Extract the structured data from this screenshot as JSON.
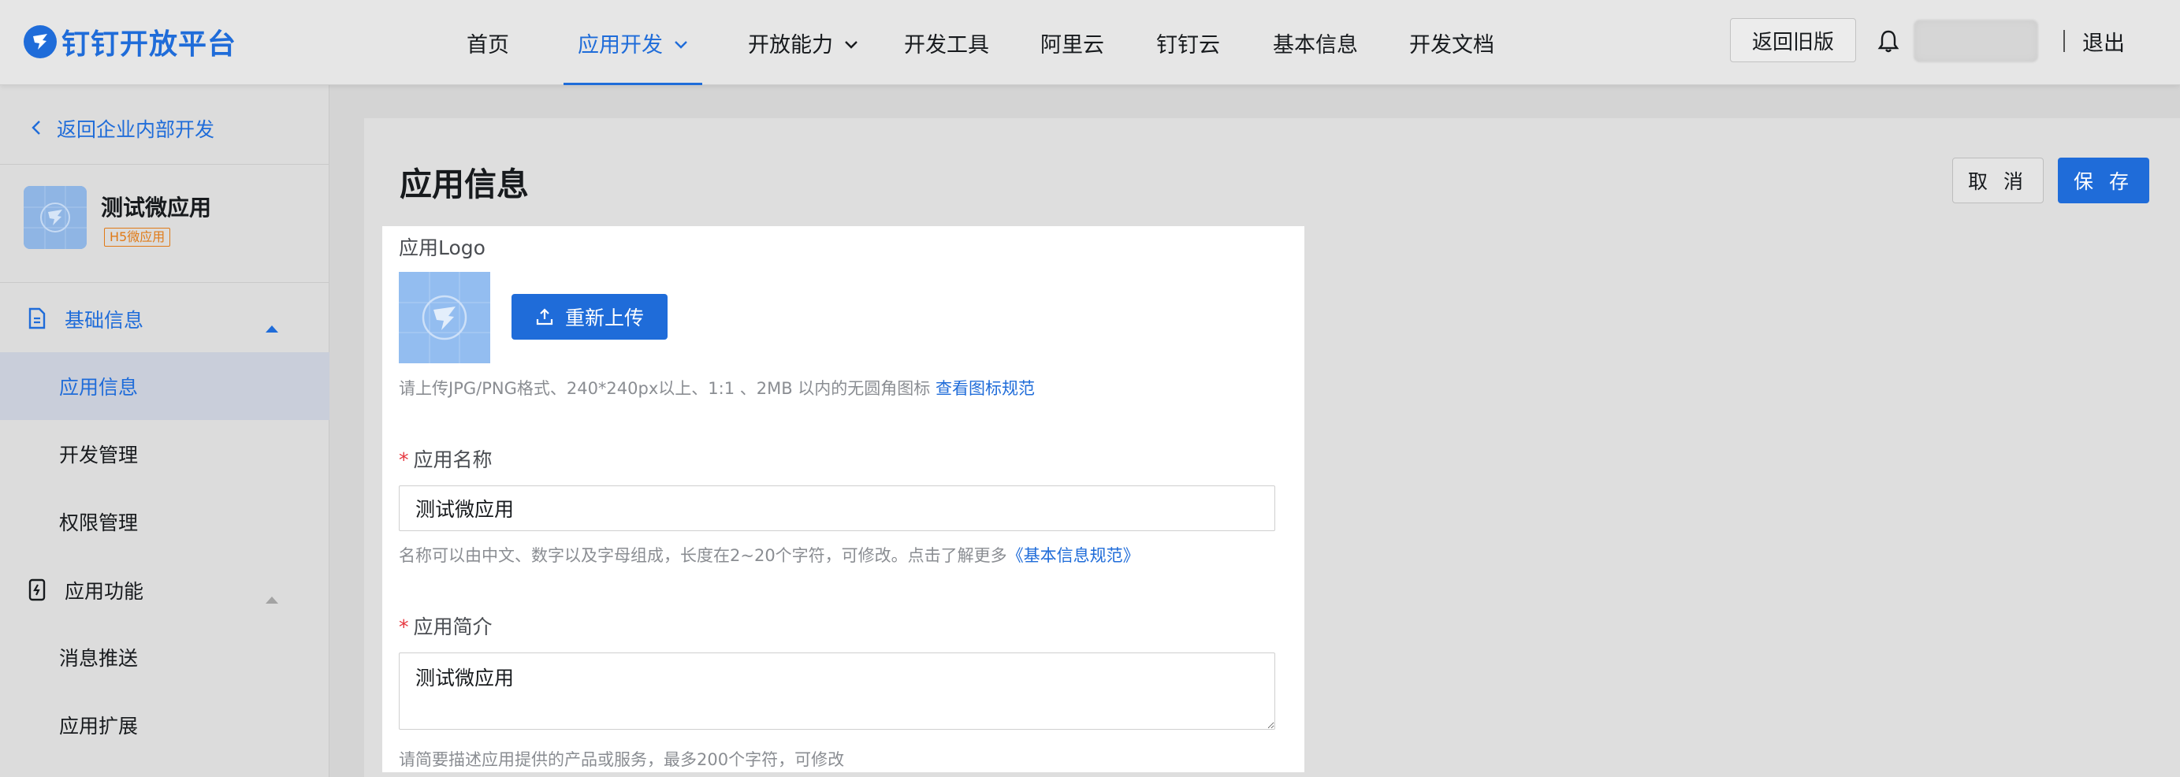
{
  "header": {
    "logo_text": "钉钉开放平台",
    "nav": [
      {
        "label": "首页"
      },
      {
        "label": "应用开发"
      },
      {
        "label": "开放能力"
      },
      {
        "label": "开发工具"
      },
      {
        "label": "阿里云"
      },
      {
        "label": "钉钉云"
      },
      {
        "label": "基本信息"
      },
      {
        "label": "开发文档"
      }
    ],
    "active_nav": "应用开发",
    "old_version_label": "返回旧版",
    "logout_label": "退出"
  },
  "sidebar": {
    "back_label": "返回企业内部开发",
    "app_name": "测试微应用",
    "app_tag": "H5微应用",
    "groups": [
      {
        "label": "基础信息",
        "expanded": true,
        "items": [
          "应用信息",
          "开发管理",
          "权限管理"
        ]
      },
      {
        "label": "应用功能",
        "expanded": true,
        "items": [
          "消息推送",
          "应用扩展"
        ]
      }
    ],
    "active_item": "应用信息"
  },
  "main": {
    "title": "应用信息",
    "cancel_label": "取 消",
    "save_label": "保 存",
    "logo_label": "应用Logo",
    "upload_label": "重新上传",
    "logo_hint": "请上传JPG/PNG格式、240*240px以上、1:1 、2MB 以内的无圆角图标",
    "logo_hint_link": "查看图标规范",
    "name_label": "应用名称",
    "name_value": "测试微应用",
    "name_hint": "名称可以由中文、数字以及字母组成，长度在2~20个字符，可修改。点击了解更多",
    "name_hint_link": "《基本信息规范》",
    "desc_label": "应用简介",
    "desc_value": "测试微应用",
    "desc_hint": "请简要描述应用提供的产品或服务，最多200个字符，可修改"
  },
  "colors": {
    "accent": "#1f6cd9",
    "required": "#e6373f",
    "tag": "#e07a17"
  },
  "icons": [
    "dingtalk-logo-icon",
    "chevron-down-icon",
    "bell-icon",
    "chevron-left-icon",
    "document-icon",
    "phone-function-icon",
    "caret-up-icon",
    "upload-icon"
  ]
}
